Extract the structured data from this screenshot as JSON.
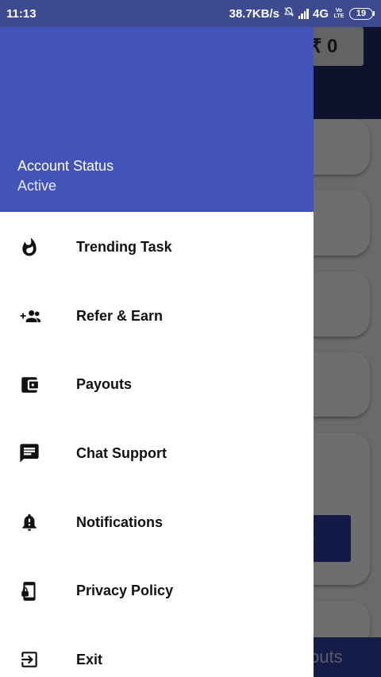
{
  "status_bar": {
    "time": "11:13",
    "net_speed": "38.7KB/s",
    "network": "4G",
    "volte": "Vo LTE",
    "battery": "19"
  },
  "background": {
    "balance": "₹ 0",
    "bottom_tab_fragment": "outs"
  },
  "drawer": {
    "account_status_label": "Account Status",
    "account_status_value": "Active",
    "items": [
      {
        "label": "Trending Task",
        "icon": "flame-icon"
      },
      {
        "label": "Refer & Earn",
        "icon": "group-add-icon"
      },
      {
        "label": "Payouts",
        "icon": "wallet-icon"
      },
      {
        "label": "Chat Support",
        "icon": "chat-icon"
      },
      {
        "label": "Notifications",
        "icon": "bell-alert-icon"
      },
      {
        "label": "Privacy Policy",
        "icon": "phone-lock-icon"
      },
      {
        "label": "Exit",
        "icon": "exit-icon"
      }
    ]
  },
  "colors": {
    "drawer_header": "#4354b8",
    "app_header": "#1f2863",
    "bottom_bar": "#2f3f9d"
  }
}
